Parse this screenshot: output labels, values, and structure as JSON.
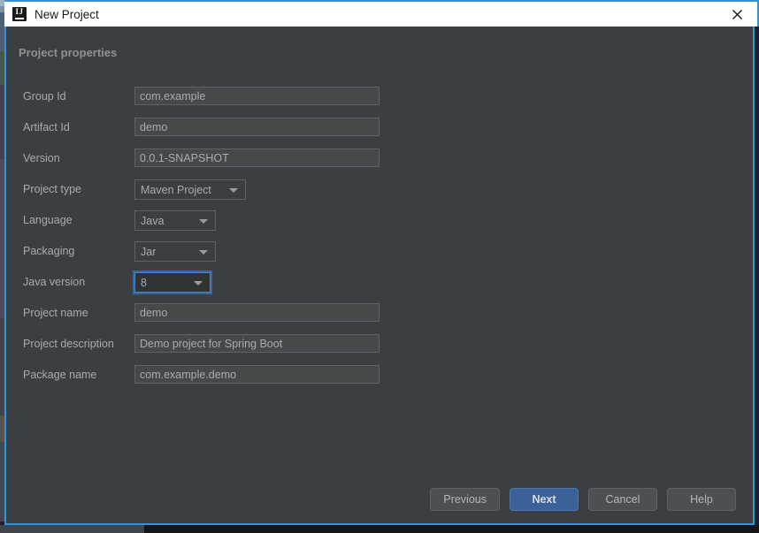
{
  "window": {
    "title": "New Project",
    "app_icon": "intellij-idea-icon",
    "close_icon": "close-icon",
    "accent_color": "#3592d6",
    "titlebar_bg": "#ffffff",
    "dialog_bg": "#3c3f41"
  },
  "dialog": {
    "section_header": "Project properties",
    "fields": [
      {
        "label": "Group Id",
        "name": "group-id",
        "type": "text",
        "value": "com.example",
        "placeholder": "",
        "focused": false
      },
      {
        "label": "Artifact Id",
        "name": "artifact-id",
        "type": "text",
        "value": "demo",
        "placeholder": "",
        "focused": false
      },
      {
        "label": "Version",
        "name": "version",
        "type": "text",
        "value": "0.0.1-SNAPSHOT",
        "placeholder": "",
        "focused": false
      },
      {
        "label": "Project type",
        "name": "project-type",
        "type": "combo",
        "value": "Maven Project",
        "width_class": "w-projecttype",
        "focused": false
      },
      {
        "label": "Language",
        "name": "language",
        "type": "combo",
        "value": "Java",
        "width_class": "w-language",
        "focused": false
      },
      {
        "label": "Packaging",
        "name": "packaging",
        "type": "combo",
        "value": "Jar",
        "width_class": "w-packaging",
        "focused": false
      },
      {
        "label": "Java version",
        "name": "java-version",
        "type": "combo",
        "value": "8",
        "width_class": "w-javaversion",
        "focused": true
      },
      {
        "label": "Project name",
        "name": "project-name",
        "type": "text",
        "value": "demo",
        "placeholder": "",
        "focused": false
      },
      {
        "label": "Project description",
        "name": "project-description",
        "type": "text",
        "value": "Demo project for Spring Boot",
        "placeholder": "",
        "focused": false
      },
      {
        "label": "Package name",
        "name": "package-name",
        "type": "text",
        "value": "com.example.demo",
        "placeholder": "",
        "focused": false
      }
    ],
    "buttons": [
      {
        "label": "Previous",
        "name": "previous-button",
        "primary": false
      },
      {
        "label": "Next",
        "name": "next-button",
        "primary": true
      },
      {
        "label": "Cancel",
        "name": "cancel-button",
        "primary": false
      },
      {
        "label": "Help",
        "name": "help-button",
        "primary": false
      }
    ]
  }
}
